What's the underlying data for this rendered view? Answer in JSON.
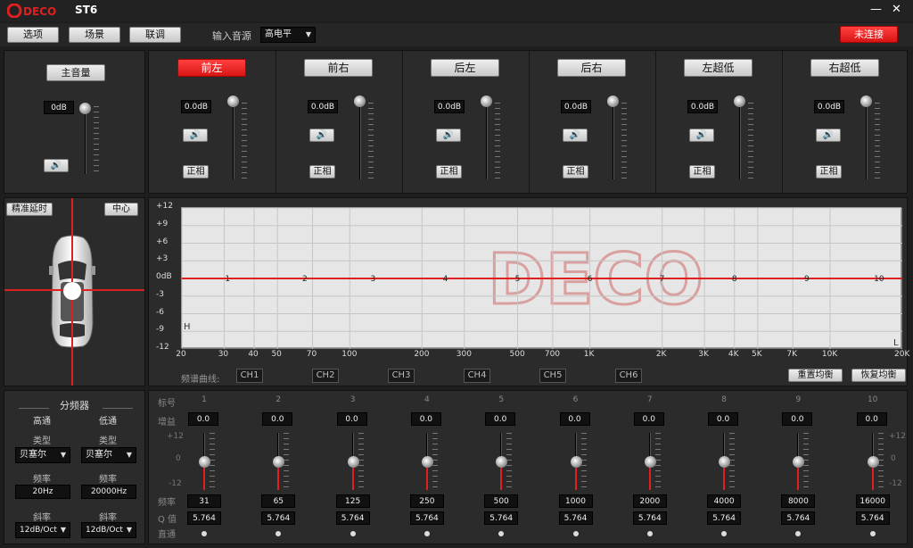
{
  "app": {
    "title": "ST6",
    "logo_text": "DECO"
  },
  "window": {
    "minimize": "—",
    "close": "✕"
  },
  "toolbar": {
    "options_label": "选项",
    "scene_label": "场景",
    "link_label": "联调",
    "input_source_label": "输入音源",
    "input_source_value": "高电平",
    "status_label": "未连接"
  },
  "master": {
    "label": "主音量",
    "value": "0dB",
    "mute_icon": "🔊",
    "level_percent": 100
  },
  "channels": [
    {
      "name": "前左",
      "value": "0.0dB",
      "phase": "正相",
      "active": true
    },
    {
      "name": "前右",
      "value": "0.0dB",
      "phase": "正相",
      "active": false
    },
    {
      "name": "后左",
      "value": "0.0dB",
      "phase": "正相",
      "active": false
    },
    {
      "name": "后右",
      "value": "0.0dB",
      "phase": "正相",
      "active": false
    },
    {
      "name": "左超低",
      "value": "0.0dB",
      "phase": "正相",
      "active": false
    },
    {
      "name": "右超低",
      "value": "0.0dB",
      "phase": "正相",
      "active": false
    }
  ],
  "delay": {
    "precise_label": "精准延时",
    "center_label": "中心"
  },
  "eq_graph": {
    "y_ticks": [
      "+12",
      "+9",
      "+6",
      "+3",
      "0dB",
      "-3",
      "-6",
      "-9",
      "-12"
    ],
    "x_ticks": [
      "20",
      "30",
      "40",
      "50",
      "70",
      "100",
      "200",
      "300",
      "500",
      "700",
      "1K",
      "2K",
      "3K",
      "4K",
      "5K",
      "7K",
      "10K",
      "20K"
    ],
    "points": [
      "1",
      "2",
      "3",
      "4",
      "5",
      "6",
      "7",
      "8",
      "9",
      "10"
    ],
    "h_marker": "H",
    "l_marker": "L",
    "curve_label": "频谱曲线:",
    "curves": [
      "CH1",
      "CH2",
      "CH3",
      "CH4",
      "CH5",
      "CH6"
    ],
    "reset_label": "重置均衡",
    "restore_label": "恢复均衡",
    "watermark": "DECO"
  },
  "crossover": {
    "title": "分频器",
    "hp_label": "高通",
    "lp_label": "低通",
    "type_label": "类型",
    "hp_type": "贝塞尔",
    "lp_type": "贝塞尔",
    "freq_label": "频率",
    "hp_freq": "20Hz",
    "lp_freq": "20000Hz",
    "slope_label": "斜率",
    "hp_slope": "12dB/Oct",
    "lp_slope": "12dB/Oct"
  },
  "eq_bands": {
    "num_label": "标号",
    "gain_label": "增益",
    "freq_label": "频率",
    "q_label": "Q 值",
    "bypass_label": "直通",
    "scale_top": "+12",
    "scale_mid": "0",
    "scale_bot": "-12",
    "bands": [
      {
        "num": "1",
        "gain": "0.0",
        "freq": "31",
        "q": "5.764"
      },
      {
        "num": "2",
        "gain": "0.0",
        "freq": "65",
        "q": "5.764"
      },
      {
        "num": "3",
        "gain": "0.0",
        "freq": "125",
        "q": "5.764"
      },
      {
        "num": "4",
        "gain": "0.0",
        "freq": "250",
        "q": "5.764"
      },
      {
        "num": "5",
        "gain": "0.0",
        "freq": "500",
        "q": "5.764"
      },
      {
        "num": "6",
        "gain": "0.0",
        "freq": "1000",
        "q": "5.764"
      },
      {
        "num": "7",
        "gain": "0.0",
        "freq": "2000",
        "q": "5.764"
      },
      {
        "num": "8",
        "gain": "0.0",
        "freq": "4000",
        "q": "5.764"
      },
      {
        "num": "9",
        "gain": "0.0",
        "freq": "8000",
        "q": "5.764"
      },
      {
        "num": "10",
        "gain": "0.0",
        "freq": "16000",
        "q": "5.764"
      }
    ]
  }
}
